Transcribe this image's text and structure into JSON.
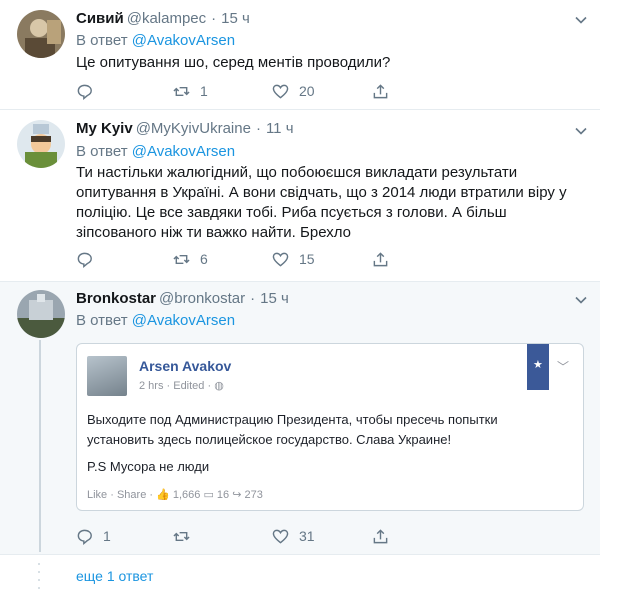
{
  "tweets": [
    {
      "name": "Сивий",
      "handle": "@kalampec",
      "time": "15 ч",
      "reply_prefix": "В ответ",
      "reply_to": "@AvakovArsen",
      "text": "Це опитування шо, серед ментів проводили?",
      "reply_count": "",
      "retweet_count": "1",
      "like_count": "20"
    },
    {
      "name": "My Kyiv",
      "handle": "@MyKyivUkraine",
      "time": "11 ч",
      "reply_prefix": "В ответ",
      "reply_to": "@AvakovArsen",
      "text_lines": [
        "Ти настільки жалюгідний, що побоюєшся викладати результати",
        "опитування в Україні. А вони свідчать, що з 2014 люди втратили віру у",
        "поліцію. Це все завдяки тобі. Риба псується з голови. А більш",
        "зіпсованого ніж ти важко найти. Брехло"
      ],
      "reply_count": "",
      "retweet_count": "6",
      "like_count": "15"
    },
    {
      "name": "Bronkostar",
      "handle": "@bronkostar",
      "time": "15 ч",
      "reply_prefix": "В ответ",
      "reply_to": "@AvakovArsen",
      "reply_count": "1",
      "retweet_count": "",
      "like_count": "31",
      "embed": {
        "name": "Arsen Avakov",
        "meta": "2 hrs · Edited · ",
        "text_lines": [
          "Выходите под Администрацию Президента, чтобы пресечь попытки",
          "установить здесь полицейское государство. Слава Украине!"
        ],
        "ps": "P.S Мусора не люди",
        "footer": "Like · Share · ",
        "likes": "1,666",
        "comments": "16",
        "shares": "273"
      }
    }
  ],
  "more_replies": "еще 1 ответ",
  "colors": {
    "link": "#1b95e0",
    "muted": "#657786",
    "border": "#e6ecf0",
    "focused_bg": "#f5f8fa"
  }
}
